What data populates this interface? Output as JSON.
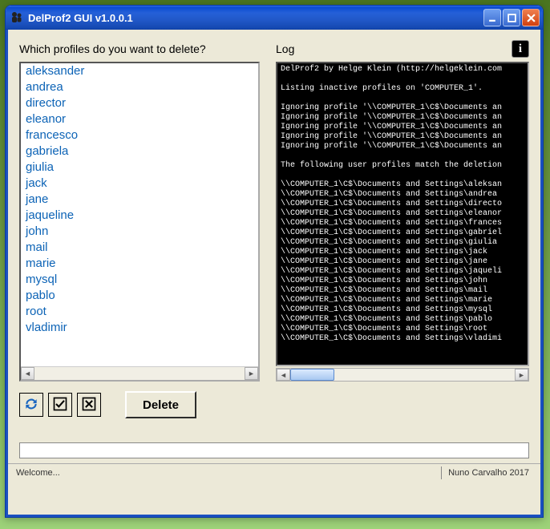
{
  "window": {
    "title": "DelProf2 GUI v1.0.0.1"
  },
  "left_panel": {
    "header": "Which profiles do you want to delete?",
    "profiles": [
      "aleksander",
      "andrea",
      "director",
      "eleanor",
      "francesco",
      "gabriela",
      "giulia",
      "jack",
      "jane",
      "jaqueline",
      "john",
      "mail",
      "marie",
      "mysql",
      "pablo",
      "root",
      "vladimir"
    ]
  },
  "right_panel": {
    "header": "Log",
    "log_lines": [
      "DelProf2 by Helge Klein (http://helgeklein.com",
      "",
      "Listing inactive profiles on 'COMPUTER_1'.",
      "",
      "Ignoring profile '\\\\COMPUTER_1\\C$\\Documents an",
      "Ignoring profile '\\\\COMPUTER_1\\C$\\Documents an",
      "Ignoring profile '\\\\COMPUTER_1\\C$\\Documents an",
      "Ignoring profile '\\\\COMPUTER_1\\C$\\Documents an",
      "Ignoring profile '\\\\COMPUTER_1\\C$\\Documents an",
      "",
      "The following user profiles match the deletion",
      "",
      "\\\\COMPUTER_1\\C$\\Documents and Settings\\aleksan",
      "\\\\COMPUTER_1\\C$\\Documents and Settings\\andrea",
      "\\\\COMPUTER_1\\C$\\Documents and Settings\\directo",
      "\\\\COMPUTER_1\\C$\\Documents and Settings\\eleanor",
      "\\\\COMPUTER_1\\C$\\Documents and Settings\\frances",
      "\\\\COMPUTER_1\\C$\\Documents and Settings\\gabriel",
      "\\\\COMPUTER_1\\C$\\Documents and Settings\\giulia",
      "\\\\COMPUTER_1\\C$\\Documents and Settings\\jack",
      "\\\\COMPUTER_1\\C$\\Documents and Settings\\jane",
      "\\\\COMPUTER_1\\C$\\Documents and Settings\\jaqueli",
      "\\\\COMPUTER_1\\C$\\Documents and Settings\\john",
      "\\\\COMPUTER_1\\C$\\Documents and Settings\\mail",
      "\\\\COMPUTER_1\\C$\\Documents and Settings\\marie",
      "\\\\COMPUTER_1\\C$\\Documents and Settings\\mysql",
      "\\\\COMPUTER_1\\C$\\Documents and Settings\\pablo",
      "\\\\COMPUTER_1\\C$\\Documents and Settings\\root",
      "\\\\COMPUTER_1\\C$\\Documents and Settings\\vladimi"
    ]
  },
  "toolbar": {
    "refresh_tooltip": "Refresh",
    "selectall_tooltip": "Select All",
    "selectnone_tooltip": "Select None",
    "delete_label": "Delete"
  },
  "status": {
    "welcome": "Welcome...",
    "credit": "Nuno Carvalho 2017"
  },
  "info_button_label": "i"
}
